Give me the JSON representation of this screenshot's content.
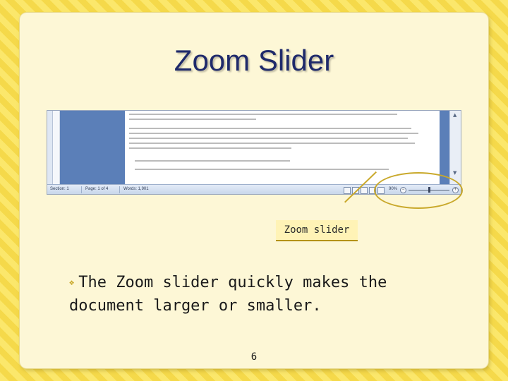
{
  "slide": {
    "title": "Zoom Slider",
    "callout_label": "Zoom slider",
    "bullet_text_line1": "The Zoom slider quickly makes the",
    "bullet_text_line2": "document larger or smaller.",
    "page_number": "6"
  },
  "screenshot": {
    "status_bar": {
      "section": "Section: 1",
      "page": "Page: 1 of 4",
      "words": "Words: 1,901",
      "zoom_percent": "90%"
    },
    "zoom_level_fraction": 0.5
  },
  "colors": {
    "title": "#1f2a6b",
    "callout_accent": "#c9a92c",
    "background_stripe_a": "#fbe76b",
    "background_stripe_b": "#f5d94a"
  },
  "icons": [
    "bullet-icon",
    "zoom-out-icon",
    "zoom-in-icon"
  ]
}
